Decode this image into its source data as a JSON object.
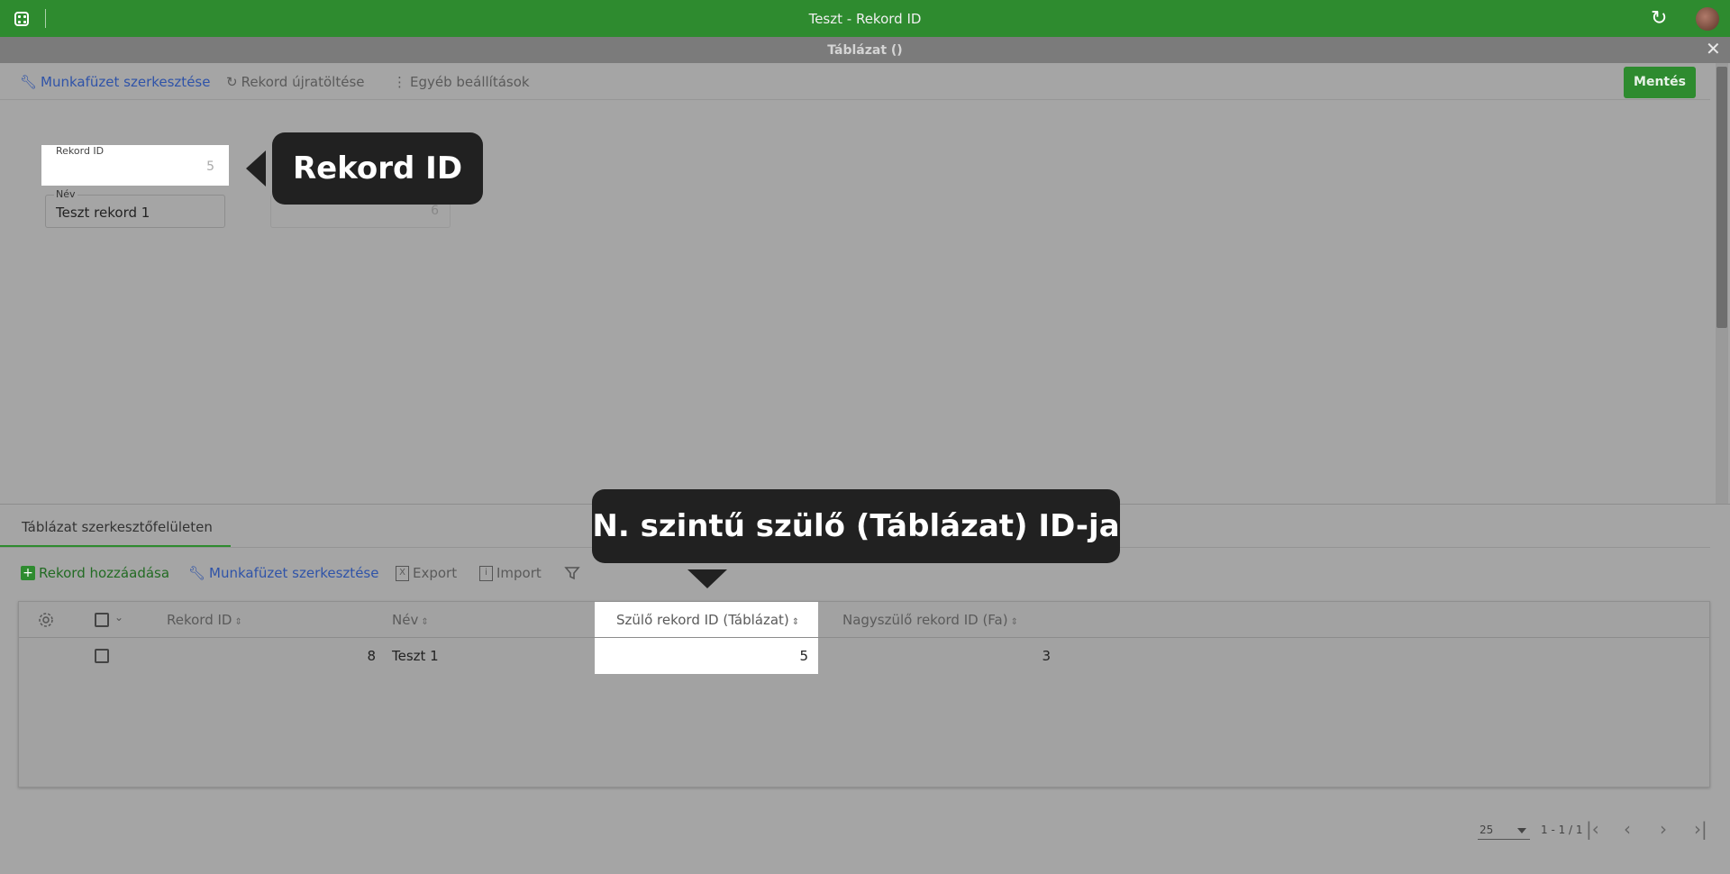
{
  "window": {
    "title": "Teszt - Rekord ID",
    "subtitle": "Táblázat ()"
  },
  "toolbar": {
    "edit_workbook": "Munkafüzet szerkesztése",
    "reload_record": "Rekord újratöltése",
    "other_settings": "Egyéb beállítások",
    "save": "Mentés"
  },
  "form": {
    "record_id_label": "Rekord ID",
    "record_id_value": "5",
    "name_label": "Név",
    "name_value": "Teszt rekord 1",
    "partial_field_value": "6"
  },
  "callouts": {
    "record_id": "Rekord ID",
    "parent_id": "N. szintű szülő (Táblázat) ID-ja"
  },
  "subpanel": {
    "tab": "Táblázat szerkesztőfelületen",
    "add_record": "Rekord hozzáadása",
    "edit_workbook": "Munkafüzet szerkesztése",
    "export": "Export",
    "import": "Import"
  },
  "grid": {
    "columns": [
      "Rekord ID",
      "Név",
      "Szülő rekord ID (Táblázat)",
      "Nagyszülő rekord ID (Fa)"
    ],
    "rows": [
      {
        "id": "8",
        "name": "Teszt 1",
        "parent": "5",
        "grandparent": "3"
      }
    ]
  },
  "pager": {
    "page_size": "25",
    "range": "1 - 1 / 1"
  },
  "colors": {
    "accent": "#2e8b2f",
    "link": "#2f53a8",
    "callout": "#212121"
  }
}
